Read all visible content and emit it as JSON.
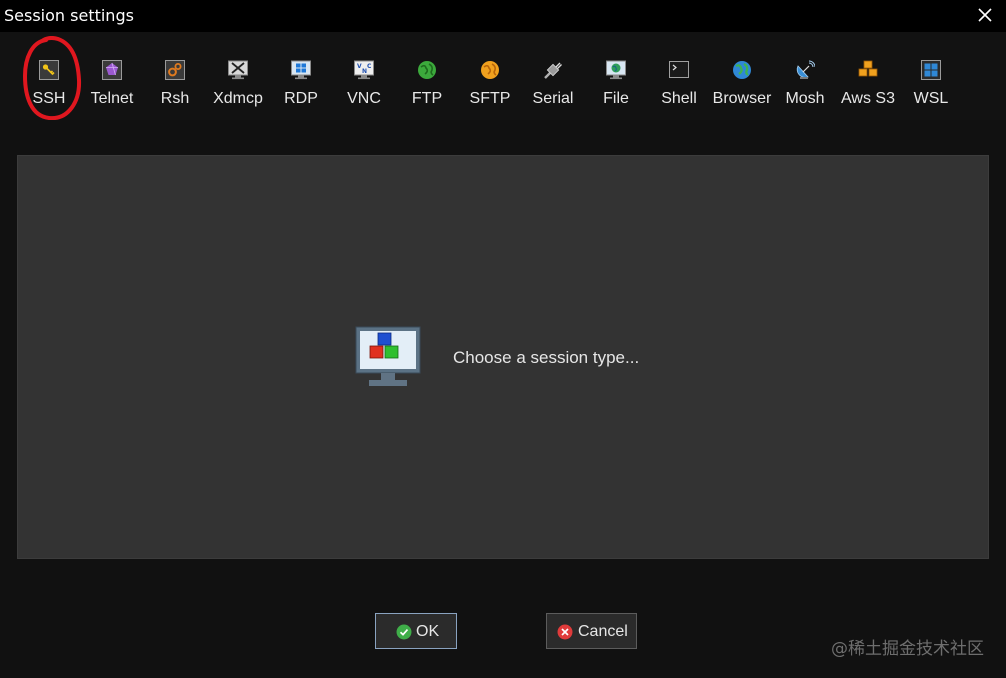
{
  "window": {
    "title": "Session settings"
  },
  "toolbar": {
    "items": [
      {
        "label": "SSH",
        "icon": "key-icon"
      },
      {
        "label": "Telnet",
        "icon": "telnet-icon"
      },
      {
        "label": "Rsh",
        "icon": "gears-icon"
      },
      {
        "label": "Xdmcp",
        "icon": "x-display-icon"
      },
      {
        "label": "RDP",
        "icon": "windows-icon"
      },
      {
        "label": "VNC",
        "icon": "vnc-icon"
      },
      {
        "label": "FTP",
        "icon": "globe-green-icon"
      },
      {
        "label": "SFTP",
        "icon": "globe-orange-icon"
      },
      {
        "label": "Serial",
        "icon": "serial-plug-icon"
      },
      {
        "label": "File",
        "icon": "file-globe-icon"
      },
      {
        "label": "Shell",
        "icon": "terminal-icon"
      },
      {
        "label": "Browser",
        "icon": "globe-icon"
      },
      {
        "label": "Mosh",
        "icon": "satellite-dish-icon"
      },
      {
        "label": "Aws S3",
        "icon": "aws-cubes-icon"
      },
      {
        "label": "WSL",
        "icon": "windows-icon"
      }
    ],
    "highlight_color": "#e0171f"
  },
  "main": {
    "prompt": "Choose a session type..."
  },
  "buttons": {
    "ok_label": "OK",
    "cancel_label": "Cancel"
  },
  "watermark": "@稀土掘金技术社区",
  "colors": {
    "titlebar": "#000000",
    "background": "#111111",
    "panel": "#333333",
    "ok_green": "#3fae49",
    "cancel_red": "#e03b3b"
  }
}
